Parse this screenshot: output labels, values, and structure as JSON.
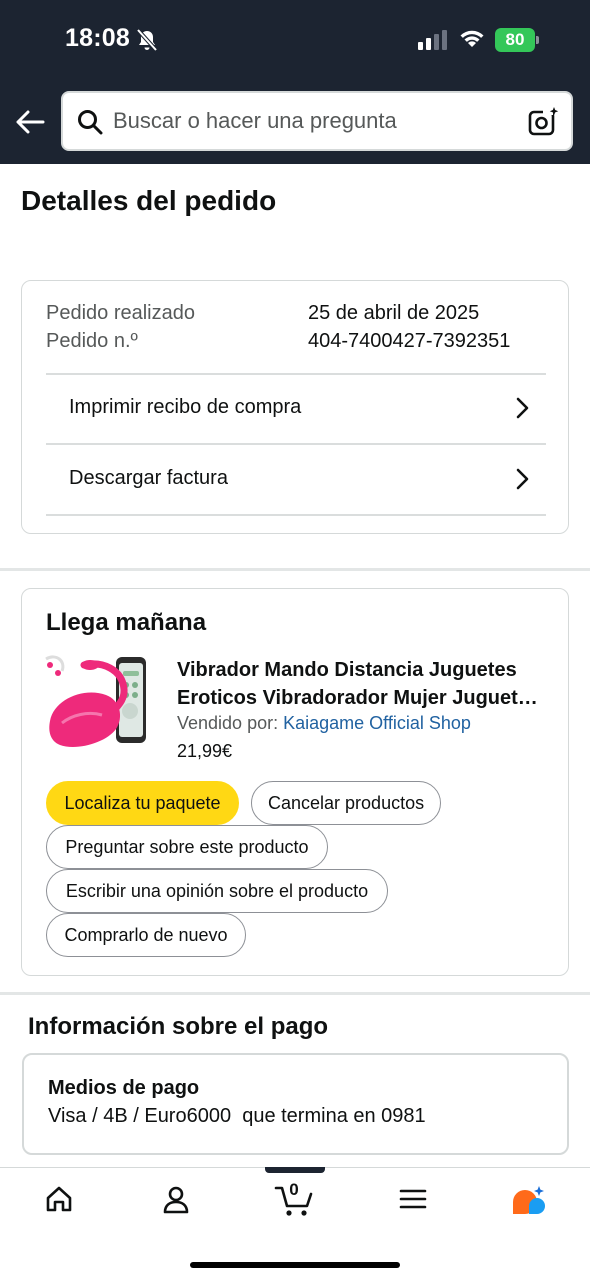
{
  "status_bar": {
    "time": "18:08",
    "battery": "80"
  },
  "header": {
    "search_placeholder": "Buscar o hacer una pregunta"
  },
  "page": {
    "title": "Detalles del pedido"
  },
  "order_summary": {
    "placed_label": "Pedido realizado",
    "placed_value": "25 de abril de 2025",
    "number_label": "Pedido n.º",
    "number_value": "404-7400427-7392351",
    "links": [
      {
        "label": "Imprimir recibo de compra"
      },
      {
        "label": "Descargar factura"
      }
    ]
  },
  "delivery": {
    "title": "Llega mañana",
    "product": {
      "title_line1": "Vibrador Mando Distancia Juguetes",
      "title_line2": "Eroticos Vibradorador Mujer Juguet…",
      "seller_prefix": "Vendido por:",
      "seller_name": "Kaiagame Official Shop",
      "price": "21,99€"
    },
    "actions": [
      {
        "label": "Localiza tu paquete",
        "primary": true
      },
      {
        "label": "Cancelar productos"
      },
      {
        "label": "Preguntar sobre este producto"
      },
      {
        "label": "Escribir una opinión sobre el producto"
      },
      {
        "label": "Comprarlo de nuevo"
      }
    ]
  },
  "payment": {
    "section_title": "Información sobre el pago",
    "method_label": "Medios de pago",
    "method_value": "Visa / 4B / Euro6000  que termina en 0981"
  },
  "bottom_nav": {
    "items": [
      "home-icon",
      "account-icon",
      "cart-icon",
      "menu-icon",
      "rufus-icon"
    ],
    "cart_count": "0"
  },
  "colors": {
    "header_bg": "#1c2431",
    "primary_button": "#ffd814",
    "link": "#2162a1",
    "battery": "#34c759",
    "product_pink": "#ee2a7b"
  }
}
